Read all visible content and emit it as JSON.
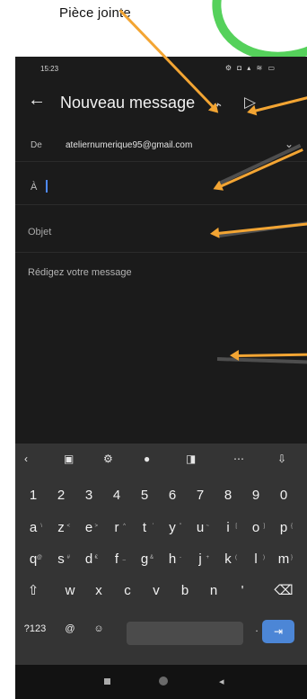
{
  "caption": "Pièce jointe",
  "status": {
    "time": "15:23",
    "icons": "⚙ ◘ ▴ ≋ ▭"
  },
  "appbar": {
    "back_icon": "←",
    "title": "Nouveau message",
    "attach_icon": "⌁",
    "send_icon": "▷"
  },
  "compose": {
    "from_label": "De",
    "from_value": "ateliernumerique95@gmail.com",
    "dropdown_icon": "⌄",
    "to_label": "À",
    "subject_placeholder": "Objet",
    "body_placeholder": "Rédigez votre message"
  },
  "keyboard": {
    "toolbar": [
      "‹",
      "▣",
      "⚙",
      "●",
      "◨",
      "⋯",
      "⇩"
    ],
    "numbers": [
      "1",
      "2",
      "3",
      "4",
      "5",
      "6",
      "7",
      "8",
      "9",
      "0"
    ],
    "row1": [
      {
        "key": "a",
        "sub": "\\"
      },
      {
        "key": "z",
        "sub": "<"
      },
      {
        "key": "e",
        "sub": ">"
      },
      {
        "key": "r",
        "sub": "^"
      },
      {
        "key": "t",
        "sub": "'"
      },
      {
        "key": "y",
        "sub": "\""
      },
      {
        "key": "u",
        "sub": "~"
      },
      {
        "key": "i",
        "sub": "["
      },
      {
        "key": "o",
        "sub": "]"
      },
      {
        "key": "p",
        "sub": "{"
      }
    ],
    "row2": [
      {
        "key": "q",
        "sub": "@"
      },
      {
        "key": "s",
        "sub": "#"
      },
      {
        "key": "d",
        "sub": "€"
      },
      {
        "key": "f",
        "sub": "_"
      },
      {
        "key": "g",
        "sub": "&"
      },
      {
        "key": "h",
        "sub": "-"
      },
      {
        "key": "j",
        "sub": "+"
      },
      {
        "key": "k",
        "sub": "("
      },
      {
        "key": "l",
        "sub": ")"
      },
      {
        "key": "m",
        "sub": "}"
      }
    ],
    "row3": [
      "⇧",
      "w",
      "x",
      "c",
      "v",
      "b",
      "n",
      "'",
      "⌫"
    ],
    "bottom": [
      "?123",
      "@",
      "☺",
      ".",
      "⇥"
    ]
  },
  "nav": {
    "back_icon": "◂"
  }
}
